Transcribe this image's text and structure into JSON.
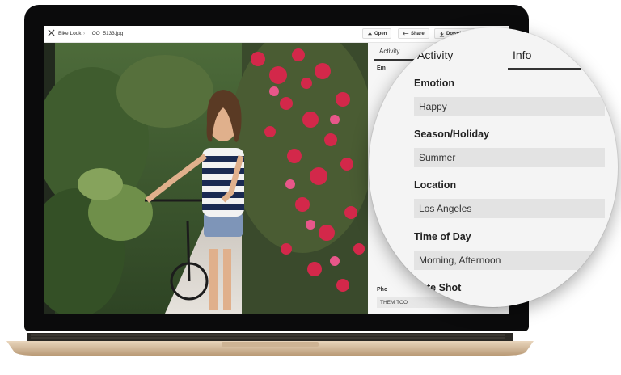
{
  "toolbar": {
    "breadcrumb_album": "Bike Look",
    "breadcrumb_sep": "›",
    "filename": "_OO_5133.jpg",
    "open_label": "Open",
    "share_label": "Share",
    "download_label": "Download",
    "more_label": "···"
  },
  "tabs": [
    {
      "label": "Activity"
    },
    {
      "label": "Info"
    }
  ],
  "sidebar": {
    "visible_label": "Em",
    "bottom_label": "Pho",
    "bottom_value": "THEM TOO"
  },
  "info_panel": {
    "fields": [
      {
        "label": "Emotion",
        "value": "Happy"
      },
      {
        "label": "Season/Holiday",
        "value": "Summer"
      },
      {
        "label": "Location",
        "value": "Los Angeles"
      },
      {
        "label": "Time of Day",
        "value": "Morning, Afternoon"
      },
      {
        "label": "Date Shot",
        "value": ""
      }
    ]
  },
  "colors": {
    "laptop_bezel": "#0b0b0c",
    "laptop_base": "#d8bf9f",
    "panel_bg": "#f4f4f4",
    "field_bg": "#e3e3e3",
    "accent_tab": "#333333"
  }
}
